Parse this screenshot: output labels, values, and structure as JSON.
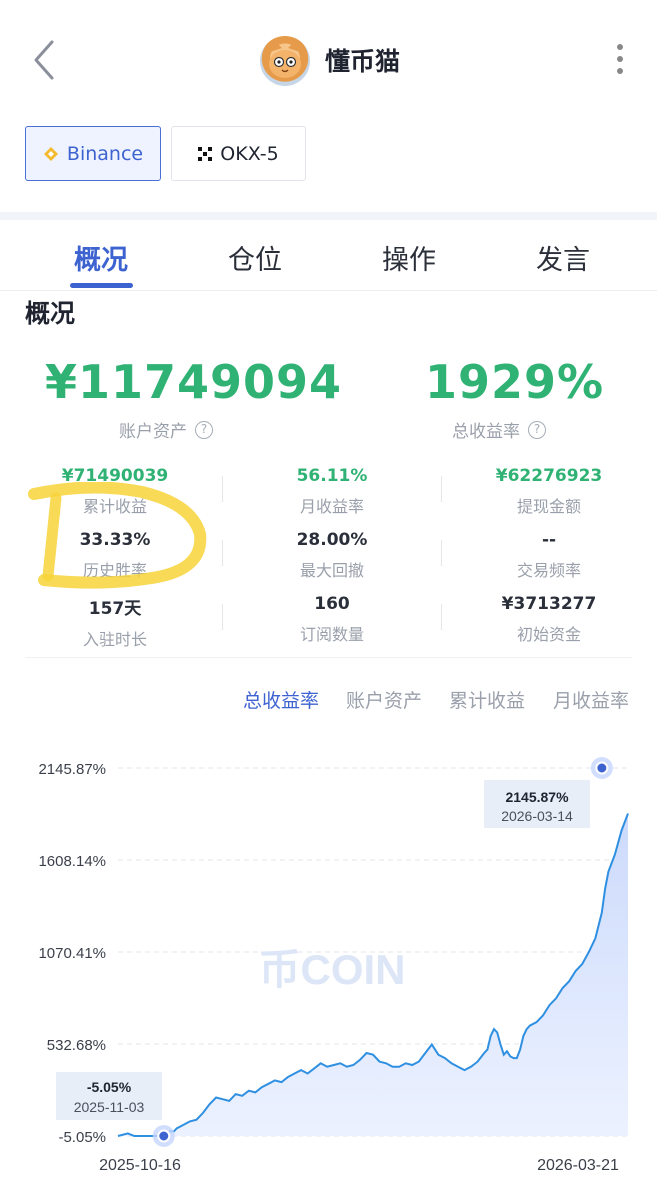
{
  "header": {
    "title": "懂币猫",
    "back_icon": "chevron-left-icon",
    "more_icon": "more-vertical-icon"
  },
  "exchanges": [
    {
      "label": "Binance",
      "icon": "binance-icon",
      "active": true
    },
    {
      "label": "OKX-5",
      "icon": "okx-icon",
      "active": false
    }
  ],
  "tabs": [
    {
      "label": "概况",
      "active": true
    },
    {
      "label": "仓位",
      "active": false
    },
    {
      "label": "操作",
      "active": false
    },
    {
      "label": "发言",
      "active": false
    }
  ],
  "overview": {
    "title": "概况",
    "account_assets": {
      "value": "¥11749094",
      "label": "账户资产"
    },
    "total_return": {
      "value": "1929%",
      "label": "总收益率"
    },
    "stats": [
      {
        "value": "¥71490039",
        "label": "累计收益",
        "green": true
      },
      {
        "value": "56.11%",
        "label": "月收益率",
        "green": true
      },
      {
        "value": "¥62276923",
        "label": "提现金额",
        "green": true
      },
      {
        "value": "33.33%",
        "label": "历史胜率",
        "green": false
      },
      {
        "value": "28.00%",
        "label": "最大回撤",
        "green": false
      },
      {
        "value": "--",
        "label": "交易频率",
        "green": false
      },
      {
        "value": "157天",
        "label": "入驻时长",
        "green": false
      },
      {
        "value": "160",
        "label": "订阅数量",
        "green": false
      },
      {
        "value": "¥3713277",
        "label": "初始资金",
        "green": false
      }
    ]
  },
  "chart_tabs": [
    {
      "label": "总收益率",
      "active": true
    },
    {
      "label": "账户资产",
      "active": false
    },
    {
      "label": "累计收益",
      "active": false
    },
    {
      "label": "月收益率",
      "active": false
    }
  ],
  "colors": {
    "accent": "#3d63d0",
    "green": "#2fb273",
    "line": "#2f8fe0",
    "highlighter": "#f7d43a"
  },
  "chart_data": {
    "type": "area",
    "watermark": "币COIN",
    "y_ticks": [
      "2145.87%",
      "1608.14%",
      "1070.41%",
      "532.68%",
      "-5.05%"
    ],
    "y_tick_values": [
      2145.87,
      1608.14,
      1070.41,
      532.68,
      -5.05
    ],
    "ylim": [
      -5.05,
      2145.87
    ],
    "x_tick_labels": [
      "2025-10-16",
      "2026-03-21"
    ],
    "x_range_days": 156,
    "series": [
      {
        "x_days": [
          0,
          3,
          5,
          8,
          10,
          12,
          14,
          15,
          16,
          17,
          18,
          20,
          22,
          24,
          26,
          28,
          30,
          32,
          34,
          36,
          38,
          40,
          42,
          44,
          46,
          48,
          50,
          52,
          54,
          56,
          58,
          60,
          62,
          64,
          66,
          68,
          70,
          72,
          74,
          76,
          78,
          80,
          82,
          84,
          86,
          88,
          90,
          92,
          94,
          96,
          98,
          100,
          102,
          104,
          106,
          108,
          110,
          112,
          113,
          114,
          115,
          116,
          117,
          118,
          119,
          120,
          121,
          122,
          123,
          124,
          125,
          126,
          128,
          130,
          132,
          134,
          136,
          138,
          140,
          142,
          144,
          146,
          148,
          149,
          150,
          152,
          154,
          156
        ],
        "y_values": [
          -5.05,
          10,
          -5,
          -5,
          -5,
          -5,
          -5.05,
          5,
          25,
          20,
          40,
          60,
          80,
          90,
          130,
          180,
          220,
          210,
          200,
          240,
          230,
          260,
          250,
          280,
          300,
          320,
          310,
          340,
          360,
          380,
          360,
          390,
          420,
          400,
          410,
          420,
          400,
          410,
          440,
          480,
          470,
          430,
          420,
          400,
          400,
          420,
          410,
          430,
          480,
          530,
          470,
          450,
          420,
          400,
          380,
          400,
          430,
          480,
          500,
          580,
          620,
          600,
          530,
          470,
          490,
          460,
          450,
          450,
          500,
          580,
          620,
          640,
          660,
          700,
          760,
          800,
          860,
          900,
          960,
          1000,
          1070,
          1150,
          1300,
          1440,
          1540,
          1640,
          1780,
          1880
        ]
      }
    ],
    "annotations": [
      {
        "value": "-5.05%",
        "date": "2025-11-03"
      },
      {
        "value": "2145.87%",
        "date": "2026-03-14"
      }
    ]
  }
}
